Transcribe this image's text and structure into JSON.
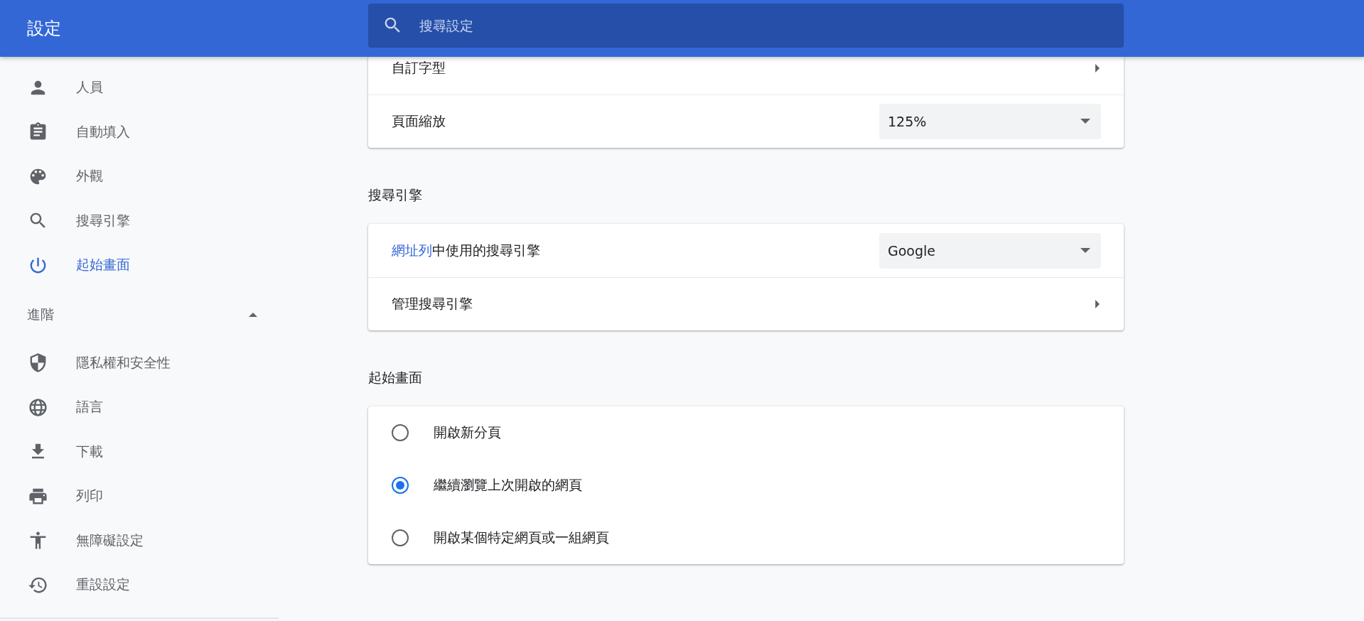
{
  "header": {
    "title": "設定",
    "search": {
      "placeholder": "搜尋設定"
    }
  },
  "sidebar": {
    "items": [
      {
        "label": "人員",
        "selected": false
      },
      {
        "label": "自動填入",
        "selected": false
      },
      {
        "label": "外觀",
        "selected": false
      },
      {
        "label": "搜尋引擎",
        "selected": false
      },
      {
        "label": "起始畫面",
        "selected": true
      }
    ],
    "advanced": {
      "label": "進階",
      "expanded": true
    },
    "advanced_items": [
      {
        "label": "隱私權和安全性",
        "selected": false
      },
      {
        "label": "語言",
        "selected": false
      },
      {
        "label": "下載",
        "selected": false
      },
      {
        "label": "列印",
        "selected": false
      },
      {
        "label": "無障礙設定",
        "selected": false
      },
      {
        "label": "重設設定",
        "selected": false
      }
    ]
  },
  "sections": [
    {
      "rows": [
        {
          "kind": "link",
          "label": "自訂字型"
        },
        {
          "kind": "select",
          "label": "頁面縮放",
          "value": "125%"
        }
      ]
    },
    {
      "heading": "搜尋引擎",
      "rows": [
        {
          "kind": "select",
          "link": "網址列",
          "label": "中使用的搜尋引擎",
          "value": "Google"
        },
        {
          "kind": "link",
          "label": "管理搜尋引擎"
        }
      ]
    },
    {
      "heading": "起始畫面",
      "rows": [
        {
          "kind": "radio",
          "label": "開啟新分頁",
          "selected": false
        },
        {
          "kind": "radio",
          "label": "繼續瀏覽上次開啟的網頁",
          "selected": true
        },
        {
          "kind": "radio",
          "label": "開啟某個特定網頁或一組網頁",
          "selected": false
        }
      ]
    }
  ]
}
